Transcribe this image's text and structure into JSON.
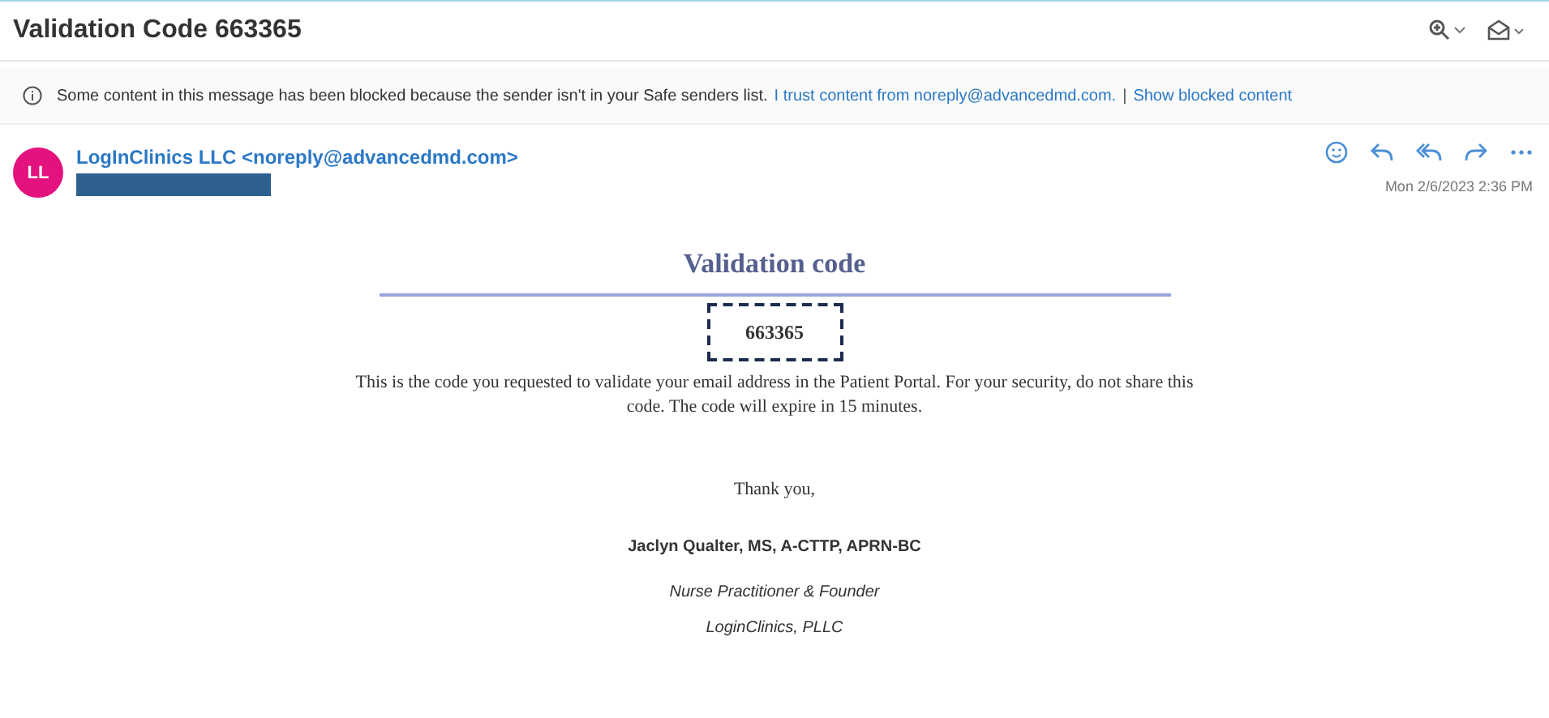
{
  "window": {
    "title": "Validation Code 663365"
  },
  "banner": {
    "message": "Some content in this message has been blocked because the sender isn't in your Safe senders list.",
    "links": [
      "I trust content from noreply@advancedmd.com.",
      "Show blocked content"
    ],
    "separator": "|"
  },
  "sender": {
    "initials": "LL",
    "name": "LogInClinics LLC <noreply@advancedmd.com>",
    "date": "Mon 2/6/2023 2:36 PM"
  },
  "body": {
    "heading": "Validation code",
    "code": "663365",
    "paragraph": "This is the code you requested to validate your email address in the Patient Portal. For your security, do not share this code. The code will expire in 15 minutes.",
    "closing": "Thank you,",
    "signer": "Jaclyn Qualter, MS, A-CTTP, APRN-BC",
    "role": "Nurse Practitioner & Founder",
    "company": "LoginClinics, PLLC"
  }
}
